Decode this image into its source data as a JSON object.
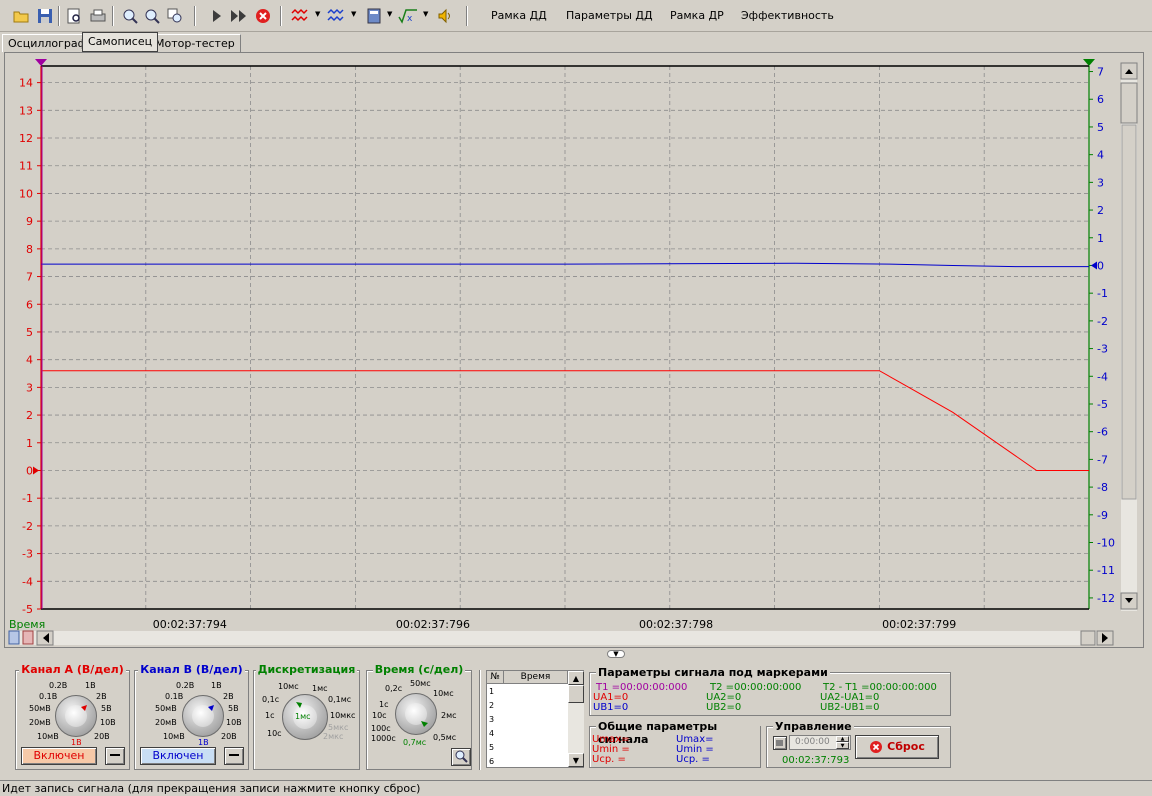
{
  "toolbar": {
    "menus": [
      "Рамка ДД",
      "Параметры ДД",
      "Рамка ДР",
      "Эффективность"
    ]
  },
  "tabs": [
    "Осциллограф",
    "Самописец",
    "Мотор-тестер"
  ],
  "chart_data": {
    "type": "line",
    "x_label": "Время",
    "x_ticks": [
      "00:02:37:794",
      "00:02:37:796",
      "00:02:37:798",
      "00:02:37:799"
    ],
    "left_axis": {
      "ticks": [
        14,
        13,
        12,
        11,
        10,
        9,
        8,
        7,
        6,
        5,
        4,
        3,
        2,
        1,
        0,
        -1,
        -2,
        -3,
        -4,
        -5
      ],
      "ylim": [
        -5,
        14.6
      ],
      "color": "#e00000"
    },
    "right_axis": {
      "ticks": [
        7,
        6,
        5,
        4,
        3,
        2,
        1,
        0,
        -1,
        -2,
        -3,
        -4,
        -5,
        -6,
        -7,
        -8,
        -9,
        -10,
        -11,
        -12
      ],
      "ylim": [
        -12.4,
        7.2
      ],
      "color": "#0000cc"
    },
    "series": [
      {
        "channel": "A",
        "color": "#ff0000",
        "axis": "left",
        "x": [
          0,
          0.16,
          0.8,
          0.87,
          0.95,
          1.0
        ],
        "y": [
          3.6,
          3.6,
          3.6,
          2.1,
          0.0,
          0.0
        ]
      },
      {
        "channel": "B",
        "color": "#0000cc",
        "axis": "right",
        "x": [
          0,
          0.5,
          0.72,
          0.81,
          0.87,
          0.93,
          1.0
        ],
        "y": [
          0.05,
          0.05,
          0.08,
          0.05,
          0.0,
          -0.04,
          -0.04
        ]
      }
    ],
    "grid": true
  },
  "controls": {
    "channel_a": {
      "title": "Канал А (В/дел)",
      "labels": [
        "0.2В",
        "1В",
        "0.1В",
        "2В",
        "50мВ",
        "5В",
        "20мВ",
        "10В",
        "10мВ",
        "20В",
        "1В"
      ],
      "button": "Включен",
      "color": "#e00000"
    },
    "channel_b": {
      "title": "Канал B (В/дел)",
      "labels": [
        "0.2В",
        "1В",
        "0.1В",
        "2В",
        "50мВ",
        "5В",
        "20мВ",
        "10В",
        "10мВ",
        "20В",
        "1В"
      ],
      "button": "Включен",
      "color": "#0000cc"
    },
    "discretization": {
      "title": "Дискретизация",
      "labels": [
        "10мс",
        "1мс",
        "0,1с",
        "0,1мс",
        "1с",
        "10мкс",
        "5мкс",
        "10с",
        "2мкс",
        "1мс"
      ],
      "color": "#008000"
    },
    "time": {
      "title": "Время (с/дел)",
      "labels": [
        "50мс",
        "0,2с",
        "10мс",
        "1с",
        "2мс",
        "10с",
        "0,5мс",
        "100с",
        "1000с",
        "0,7мс"
      ],
      "color": "#008000"
    }
  },
  "table": {
    "headers": [
      "№",
      "Время"
    ],
    "rows": [
      "1",
      "2",
      "3",
      "4",
      "5",
      "6"
    ]
  },
  "marker_params": {
    "title": "Параметры сигнала под маркерами",
    "t1": "T1 =00:00:00:000",
    "t2": "T2 =00:00:00:000",
    "t2t1": "T2 - T1 =00:00:00:000",
    "ua1": "UA1=0",
    "ub1": "UB1=0",
    "ua2": "UA2=0",
    "ub2": "UB2=0",
    "uadiff": "UA2-UA1=0",
    "ubdiff": "UB2-UB1=0"
  },
  "general_params": {
    "title": "Общие параметры сигнала",
    "a": [
      "Umax=",
      "Umin =",
      "Uср. ="
    ],
    "b": [
      "Umax=",
      "Umin =",
      "Uср. ="
    ]
  },
  "control": {
    "title": "Управление",
    "time_value": "0:00:00",
    "reset_button": "Сброс",
    "elapsed": "00:02:37:793"
  },
  "status": "Идет запись сигнала (для прекращения записи нажмите кнопку сброс)"
}
